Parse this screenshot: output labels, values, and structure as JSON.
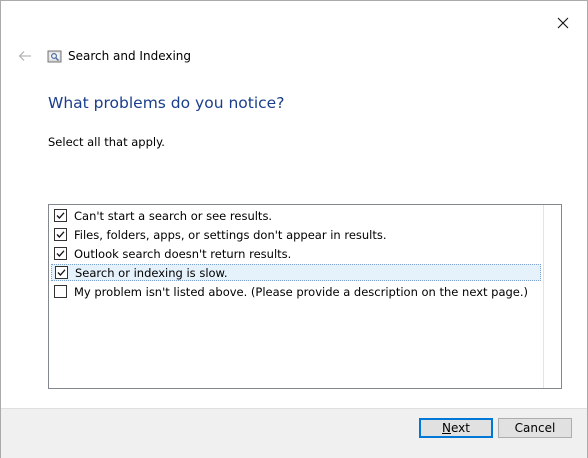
{
  "window": {
    "title": "Search and Indexing"
  },
  "page": {
    "heading": "What problems do you notice?",
    "instruction": "Select all that apply."
  },
  "options": [
    {
      "label": "Can't start a search or see results.",
      "checked": true
    },
    {
      "label": "Files, folders, apps, or settings don't appear in results.",
      "checked": true
    },
    {
      "label": "Outlook search doesn't return results.",
      "checked": true
    },
    {
      "label": "Search or indexing is slow.",
      "checked": true,
      "selected": true
    },
    {
      "label": "My problem isn't listed above. (Please provide a description on the next page.)",
      "checked": false
    }
  ],
  "buttons": {
    "next_first": "N",
    "next_rest": "ext",
    "cancel": "Cancel"
  },
  "icons": {
    "back": "back-arrow-icon",
    "app": "search-indexing-icon",
    "close": "close-icon",
    "check": "checkmark-icon"
  }
}
